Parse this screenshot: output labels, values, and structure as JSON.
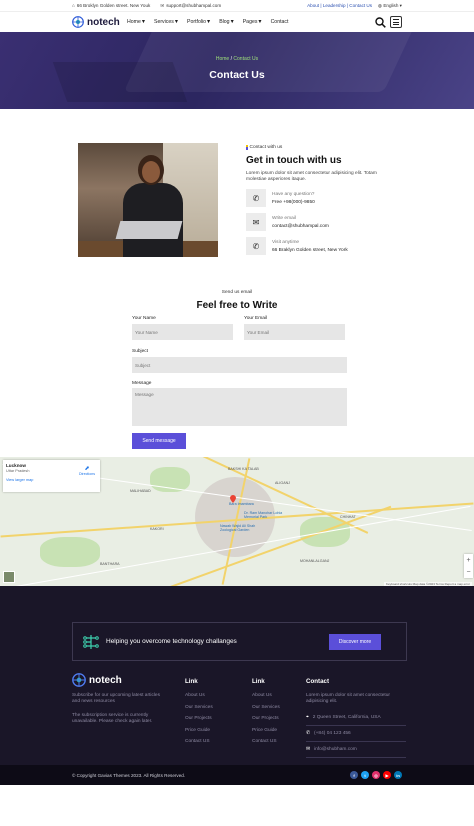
{
  "topbar": {
    "address": "66 Broklyn Golden street. New Youk",
    "email": "support@shubhampal.com",
    "links": "About | Leadership | Contact Us",
    "language": "English"
  },
  "nav": {
    "logo": "notech",
    "menu": [
      "Home▼",
      "Services▼",
      "Portfolio▼",
      "Blog▼",
      "Pages▼",
      "Contact"
    ]
  },
  "hero": {
    "crumb_home": "Home",
    "crumb_sep": " / ",
    "crumb_current": "Contact Us",
    "title": "Contact Us"
  },
  "about": {
    "tag": "Contact with us",
    "title": "Get in touch with us",
    "desc": "Lorem ipsum dolor sit amet consectetur adipisicing elit. Totam molestiae asperiores itaque.",
    "items": [
      {
        "icon": "phone-icon",
        "label": "Have any question?",
        "value": "Free +98(000)-9850"
      },
      {
        "icon": "mail-icon",
        "label": "Write email",
        "value": "contact@shubhampal.com"
      },
      {
        "icon": "location-icon",
        "label": "Visit anytime",
        "value": "66 Braklyn Golden street, New York"
      }
    ]
  },
  "form": {
    "tag": "Send us email",
    "title": "Feel free to Write",
    "name_label": "Your Name",
    "name_placeholder": "Your Name",
    "email_label": "Your Email",
    "email_placeholder": "Your Email",
    "subject_label": "Subject",
    "subject_placeholder": "Subject",
    "message_label": "Message",
    "message_placeholder": "Message",
    "submit": "Send message"
  },
  "map": {
    "card_title": "Lucknow",
    "card_sub": "Uttar Pradesh",
    "card_link": "View larger map",
    "directions": "Directions",
    "footer": "Keyboard shortcuts   Map data ©2023   Terms   Report a map error",
    "labels": [
      "Bara Imambara",
      "Dr. Ram Manohar Lohia Memorial Park",
      "Nawab Wajid Ali Shah Zoological Garden",
      "ALIGANJ",
      "BAKSHI KA TALAB",
      "CHINHAT",
      "MALIHABAD",
      "KAKORI",
      "MOHANLALGANJ",
      "BANTHARA"
    ]
  },
  "footer": {
    "cta_text": "Helping you overcome technology challanges",
    "cta_button": "Discover more",
    "logo": "notech",
    "about_text": "Subscribe for our upcoming latest articles and news resources",
    "subscribe_note": "The subscription service is currently unavailable. Please check again later.",
    "link_col1_title": "Link",
    "link_col1": [
      "About Us",
      "Our Services",
      "Our Projects",
      "Price Guide",
      "Contact US"
    ],
    "link_col2_title": "Link",
    "link_col2": [
      "About Us",
      "Our Services",
      "Our Projects",
      "Price Guide",
      "Contact US"
    ],
    "contact_title": "Contact",
    "contact_desc": "Lorem ipsum dolor sit amet consectetur adipisicing elit.",
    "contact_items": [
      "2 Queen Street, California, USA",
      "(+84) 04 123 456",
      "info@shubham.com"
    ],
    "copyright": "© Copyright Gavias Themes 2023. All Rights Reserved."
  },
  "colors": {
    "accent": "#5b4fd9",
    "dark": "#1a1628",
    "crumb": "#9fe37a"
  }
}
